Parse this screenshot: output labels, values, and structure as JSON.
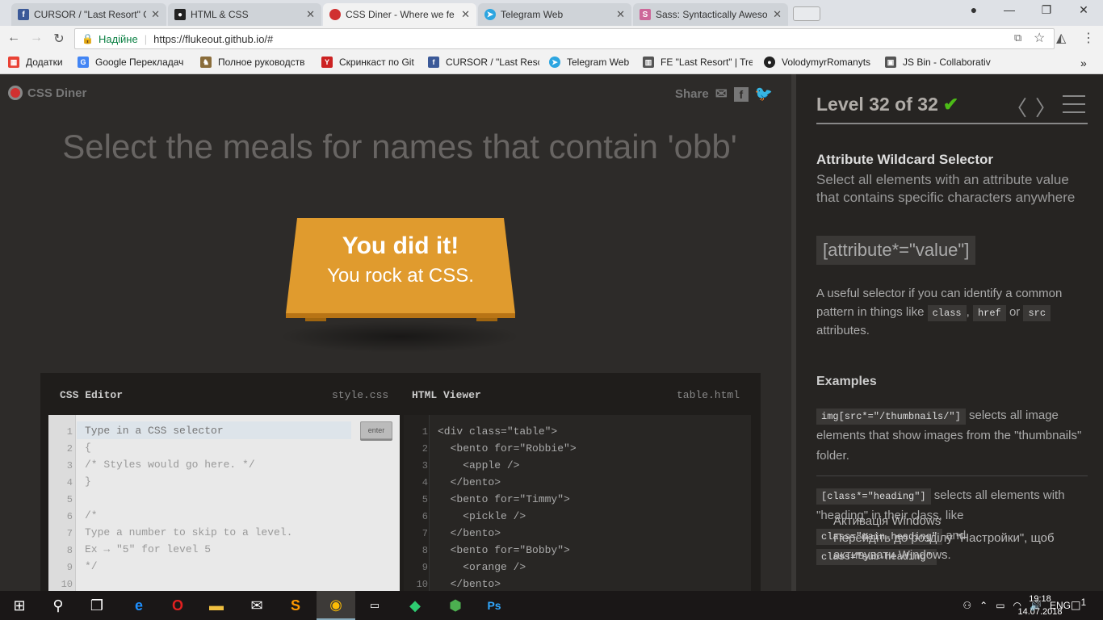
{
  "browser": {
    "tabs": [
      {
        "title": "CURSOR / \"Last Resort\" G",
        "fav": "facebook-icon",
        "color": "#3b5998"
      },
      {
        "title": "HTML & CSS",
        "fav": "github-icon",
        "color": "#222222"
      },
      {
        "title": "CSS Diner - Where we fe",
        "fav": "css-diner-icon",
        "color": "#d03030"
      },
      {
        "title": "Telegram Web",
        "fav": "telegram-icon",
        "color": "#2ca5e0"
      },
      {
        "title": "Sass: Syntactically Aweso",
        "fav": "sass-icon",
        "color": "#cd6799"
      }
    ],
    "address": {
      "secure_label": "Надійне",
      "url": "https://flukeout.github.io/#"
    },
    "bookmarks": [
      {
        "label": "Додатки",
        "icon": "apps-icon",
        "color": "#e94235"
      },
      {
        "label": "Google Перекладач",
        "icon": "google-translate-icon",
        "color": "#4285f4"
      },
      {
        "label": "Полное руководств",
        "icon": "bookmark-icon",
        "color": "#8a6d3b"
      },
      {
        "label": "Скринкаст по Git",
        "icon": "git-icon",
        "color": "#cc2222"
      },
      {
        "label": "CURSOR / \"Last Resc",
        "icon": "facebook-icon",
        "color": "#3b5998"
      },
      {
        "label": "Telegram Web",
        "icon": "telegram-icon",
        "color": "#2ca5e0"
      },
      {
        "label": "FE \"Last Resort\" | Tre",
        "icon": "trello-icon",
        "color": "#555555"
      },
      {
        "label": "VolodymyrRomanyts",
        "icon": "github-icon",
        "color": "#222222"
      },
      {
        "label": "JS Bin - Collaborativ",
        "icon": "jsbin-icon",
        "color": "#555555"
      }
    ],
    "more_label": "»"
  },
  "header": {
    "logo": "CSS Diner",
    "share": "Share"
  },
  "order": "Select the meals for names that contain 'obb'",
  "win": {
    "line1": "You did it!",
    "line2": "You rock at CSS."
  },
  "editor": {
    "css_title": "CSS Editor",
    "css_file": "style.css",
    "html_title": "HTML Viewer",
    "html_file": "table.html",
    "input_placeholder": "Type in a CSS selector",
    "enter_label": "enter",
    "css_lines": [
      "",
      "{",
      "/* Styles would go here. */",
      "}",
      "",
      "/*",
      "Type a number to skip to a level.",
      "Ex → \"5\" for level 5",
      "*/",
      ""
    ],
    "line_numbers": [
      "1",
      "2",
      "3",
      "4",
      "5",
      "6",
      "7",
      "8",
      "9",
      "10"
    ],
    "html_lines": [
      "<div class=\"table\">",
      "  <bento for=\"Robbie\">",
      "    <apple />",
      "  </bento>",
      "  <bento for=\"Timmy\">",
      "    <pickle />",
      "  </bento>",
      "  <bento for=\"Bobby\">",
      "    <orange />",
      "  </bento>"
    ]
  },
  "sidebar": {
    "level": "Level 32 of 32",
    "check": "✔",
    "selector_name": "Attribute Wildcard Selector",
    "title": "Select all elements with an attribute value that contains specific characters anywhere",
    "syntax": "[attribute*=\"value\"]",
    "hint_pre": "A useful selector if you can identify a common pattern in things like",
    "hint_class": "class",
    "hint_href": "href",
    "hint_or": "or",
    "hint_src": "src",
    "hint_post": "attributes.",
    "examples_title": "Examples",
    "ex1_code": "img[src*=\"/thumbnails/\"]",
    "ex1_text": "selects all image elements that show images from the \"thumbnails\" folder.",
    "ex2_code": "[class*=\"heading\"]",
    "ex2_text": "selects all elements with \"heading\" in their class, like",
    "ex2_code2": "class=\"main-heading\"",
    "ex2_and": "and",
    "ex2_code3": "class=\"sub-heading\""
  },
  "watermark": {
    "line1": "Активація Windows",
    "line2": "Перейдіть до розділу \"Настройки\", щоб",
    "line3": "активувати Windows."
  },
  "taskbar": {
    "lang": "ENG",
    "time": "19:18",
    "date": "14.07.2018",
    "notif": "1"
  }
}
